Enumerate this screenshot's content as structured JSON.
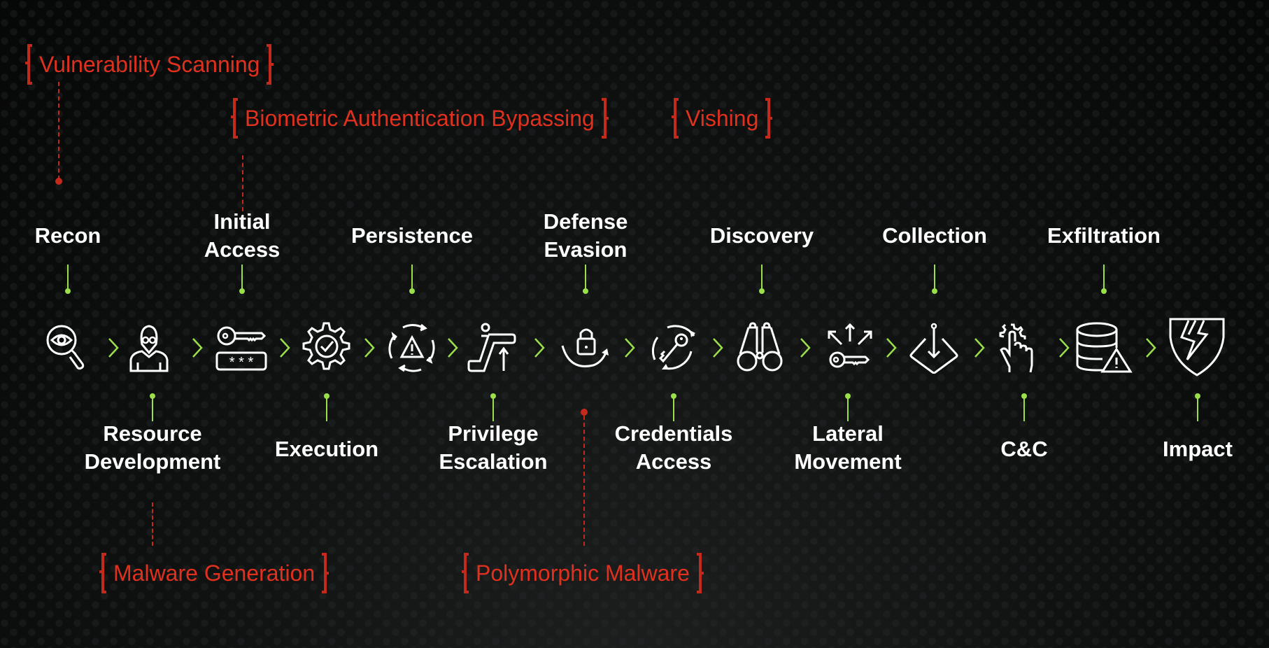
{
  "colors": {
    "background": "#0b0c0c",
    "accent_green": "#9be04a",
    "technique_red": "#e0301e",
    "label_white": "#ffffff"
  },
  "stages": [
    {
      "label": "Recon",
      "position": "top",
      "icon": "magnifier-eye-icon"
    },
    {
      "label": "Resource Development",
      "position": "bottom",
      "icon": "hacker-person-icon"
    },
    {
      "label": "Initial Access",
      "position": "top",
      "icon": "key-password-icon"
    },
    {
      "label": "Execution",
      "position": "bottom",
      "icon": "gear-check-icon"
    },
    {
      "label": "Persistence",
      "position": "top",
      "icon": "cycle-warning-icon"
    },
    {
      "label": "Privilege Escalation",
      "position": "bottom",
      "icon": "escalator-icon"
    },
    {
      "label": "Defense Evasion",
      "position": "top",
      "icon": "lock-arrow-icon"
    },
    {
      "label": "Credentials Access",
      "position": "bottom",
      "icon": "key-cycle-icon"
    },
    {
      "label": "Discovery",
      "position": "top",
      "icon": "binoculars-icon"
    },
    {
      "label": "Lateral Movement",
      "position": "bottom",
      "icon": "key-arrows-icon"
    },
    {
      "label": "Collection",
      "position": "top",
      "icon": "diamond-arrow-down-icon"
    },
    {
      "label": "C&C",
      "position": "bottom",
      "icon": "hand-gear-icon"
    },
    {
      "label": "Exfiltration",
      "position": "top",
      "icon": "database-warning-icon"
    },
    {
      "label": "Impact",
      "position": "bottom",
      "icon": "shield-lightning-icon"
    }
  ],
  "techniques": [
    {
      "label": "Vulnerability Scanning",
      "linked_stage": "Recon"
    },
    {
      "label": "Biometric Authentication Bypassing",
      "linked_stage": "Initial Access"
    },
    {
      "label": "Vishing",
      "linked_stage": "Initial Access"
    },
    {
      "label": "Malware Generation",
      "linked_stage": "Resource Development"
    },
    {
      "label": "Polymorphic Malware",
      "linked_stage": "Defense Evasion"
    }
  ]
}
